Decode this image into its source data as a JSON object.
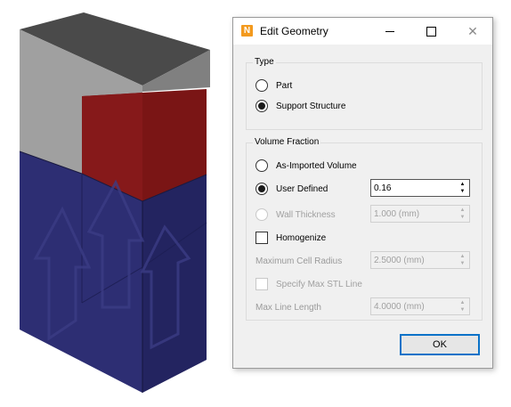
{
  "dialog": {
    "title": "Edit Geometry",
    "app_icon_letter": "N",
    "type_group": {
      "label": "Type",
      "options": [
        {
          "label": "Part",
          "selected": false
        },
        {
          "label": "Support Structure",
          "selected": true
        }
      ]
    },
    "volume_group": {
      "label": "Volume Fraction",
      "as_imported": {
        "label": "As-Imported Volume",
        "selected": false
      },
      "user_defined": {
        "label": "User Defined",
        "selected": true,
        "value": "0.16"
      },
      "wall_thickness": {
        "label": "Wall Thickness",
        "enabled": false,
        "value": "1.000 (mm)"
      },
      "homogenize": {
        "label": "Homogenize",
        "checked": false
      },
      "max_cell_radius": {
        "label": "Maximum Cell Radius",
        "enabled": false,
        "value": "2.5000 (mm)"
      },
      "specify_max_stl": {
        "label": "Specify Max STL Line",
        "enabled": false,
        "checked": false
      },
      "max_line_length": {
        "label": "Max Line Length",
        "enabled": false,
        "value": "4.0000 (mm)"
      }
    },
    "ok_label": "OK"
  },
  "colors": {
    "grey_top": "#4d4d4d",
    "grey_front": "#9a9a9a",
    "grey_side": "#7a7a7a",
    "red_front": "#7d1616",
    "blue_front": "#2b2c72",
    "blue_side": "#24255f",
    "accent": "#0a72c8"
  }
}
